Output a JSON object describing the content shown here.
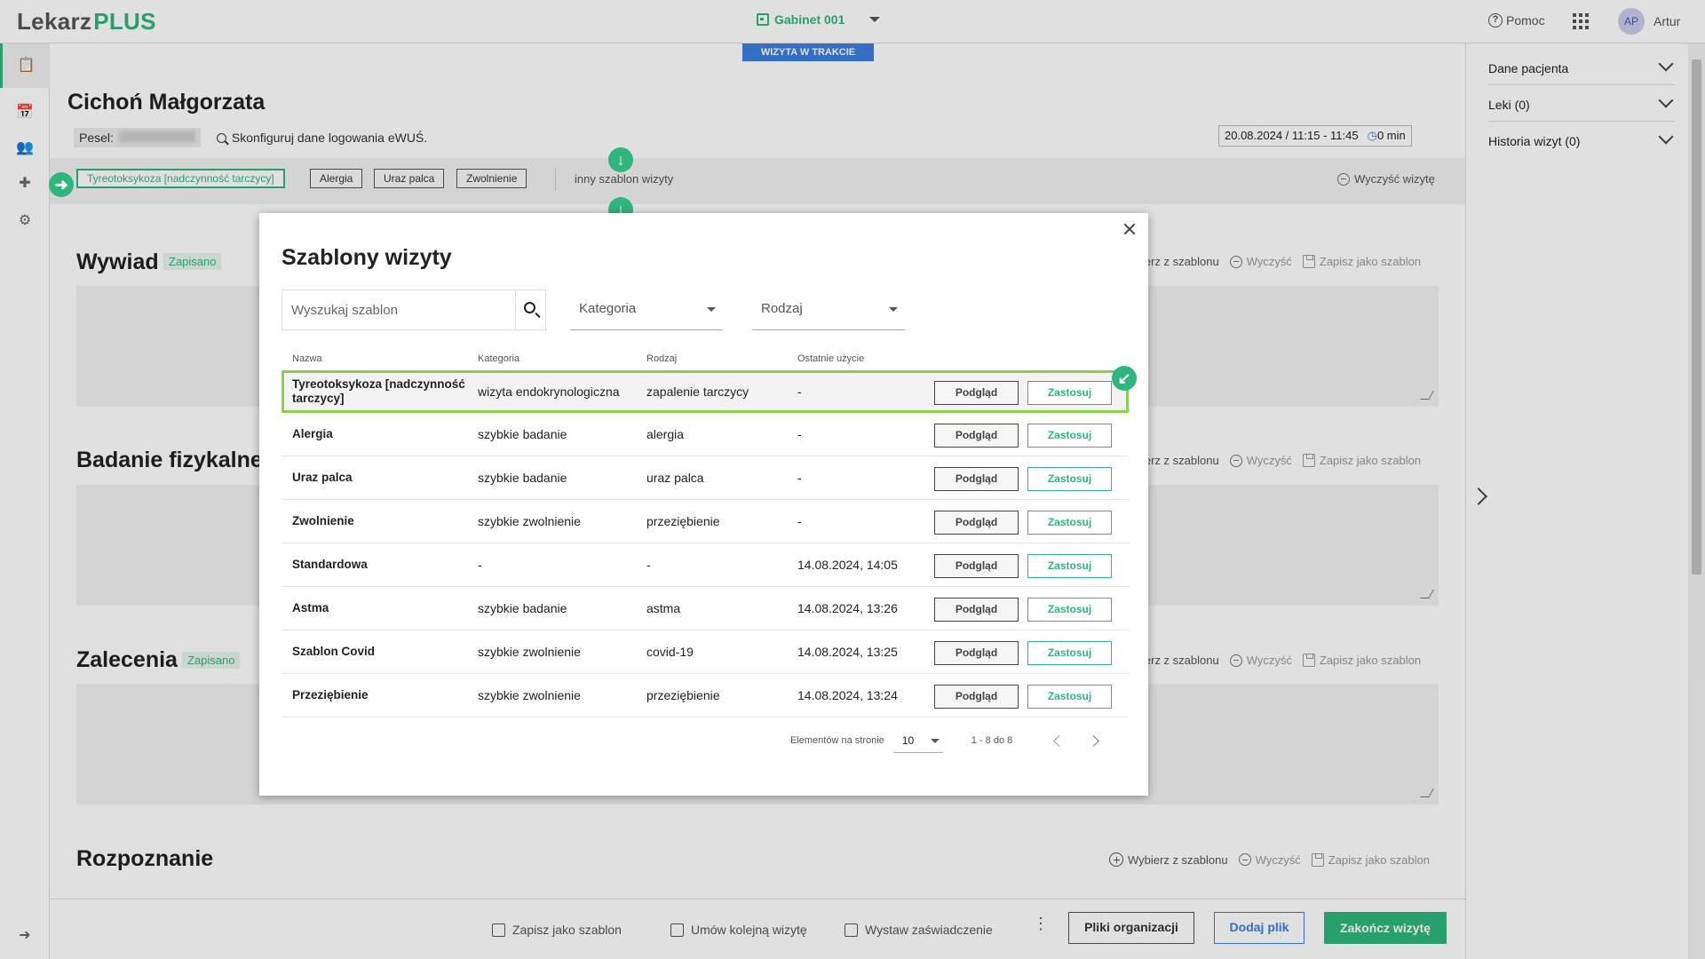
{
  "app": {
    "logo_main": "Lekarz",
    "logo_accent": "PLUS"
  },
  "topbar": {
    "gabinet": "Gabinet 001",
    "help": "Pomoc",
    "avatar_initials": "AP",
    "user": "Artur"
  },
  "visit": {
    "status_badge": "WIZYTA W TRAKCIE",
    "patient_name": "Cichoń Małgorzata",
    "pesel_label": "Pesel:",
    "ewus_link": "Skonfiguruj dane logowania eWUŚ.",
    "date_range": "20.08.2024 / 11:15 - 11:45",
    "duration": "0 min"
  },
  "tags": {
    "items": [
      "Tyreotoksykoza [nadczynność tarczycy]",
      "Alergia",
      "Uraz palca",
      "Zwolnienie"
    ],
    "other": "inny szablon wizyty",
    "clear": "Wyczyść wizytę"
  },
  "sections": {
    "wywiad": {
      "title": "Wywiad",
      "status": "Zapisano"
    },
    "badanie": {
      "title": "Badanie fizykalne"
    },
    "zalecenia": {
      "title": "Zalecenia",
      "status": "Zapisano"
    },
    "rozpoznanie": {
      "title": "Rozpoznanie"
    },
    "actions": {
      "choose": "Wybierz z szablonu",
      "choose_cut": "ierz z szablonu",
      "choose_cut2": "bierz z szablonu",
      "clear": "Wyczyść",
      "save": "Zapisz jako szablon"
    }
  },
  "bottombar": {
    "save_template": "Zapisz jako szablon",
    "schedule": "Umów kolejną wizytę",
    "certificate": "Wystaw zaświadczenie",
    "org_files": "Pliki organizacji",
    "add_file": "Dodaj plik",
    "finish": "Zakończ wizytę"
  },
  "rightpanel": {
    "items": [
      {
        "label": "Dane pacjenta"
      },
      {
        "label": "Leki  (0)"
      },
      {
        "label": "Historia wizyt (0)"
      }
    ]
  },
  "modal": {
    "title": "Szablony wizyty",
    "search_placeholder": "Wyszukaj szablon",
    "filter_category": "Kategoria",
    "filter_type": "Rodzaj",
    "columns": {
      "name": "Nazwa",
      "category": "Kategoria",
      "type": "Rodzaj",
      "last_used": "Ostatnie użycie"
    },
    "preview_label": "Podgląd",
    "apply_label": "Zastosuj",
    "rows": [
      {
        "name": "Tyreotoksykoza [nadczynność tarczycy]",
        "category": "wizyta endokrynologiczna",
        "type": "zapalenie tarczycy",
        "last_used": "-"
      },
      {
        "name": "Alergia",
        "category": "szybkie badanie",
        "type": "alergia",
        "last_used": "-"
      },
      {
        "name": "Uraz palca",
        "category": "szybkie badanie",
        "type": "uraz palca",
        "last_used": "-"
      },
      {
        "name": "Zwolnienie",
        "category": "szybkie zwolnienie",
        "type": "przeziębienie",
        "last_used": "-"
      },
      {
        "name": "Standardowa",
        "category": "-",
        "type": "-",
        "last_used": "14.08.2024, 14:05"
      },
      {
        "name": "Astma",
        "category": "szybkie badanie",
        "type": "astma",
        "last_used": "14.08.2024, 13:26"
      },
      {
        "name": "Szablon Covid",
        "category": "szybkie zwolnienie",
        "type": "covid-19",
        "last_used": "14.08.2024, 13:25"
      },
      {
        "name": "Przeziębienie",
        "category": "szybkie zwolnienie",
        "type": "przeziębienie",
        "last_used": "14.08.2024, 13:24"
      }
    ],
    "pagination": {
      "per_page_label": "Elementów na stronie",
      "per_page": "10",
      "range": "1 - 8 do 8"
    }
  },
  "colors": {
    "accent": "#2fb57e",
    "blue": "#3d7ede",
    "highlight": "#8bd14a"
  }
}
